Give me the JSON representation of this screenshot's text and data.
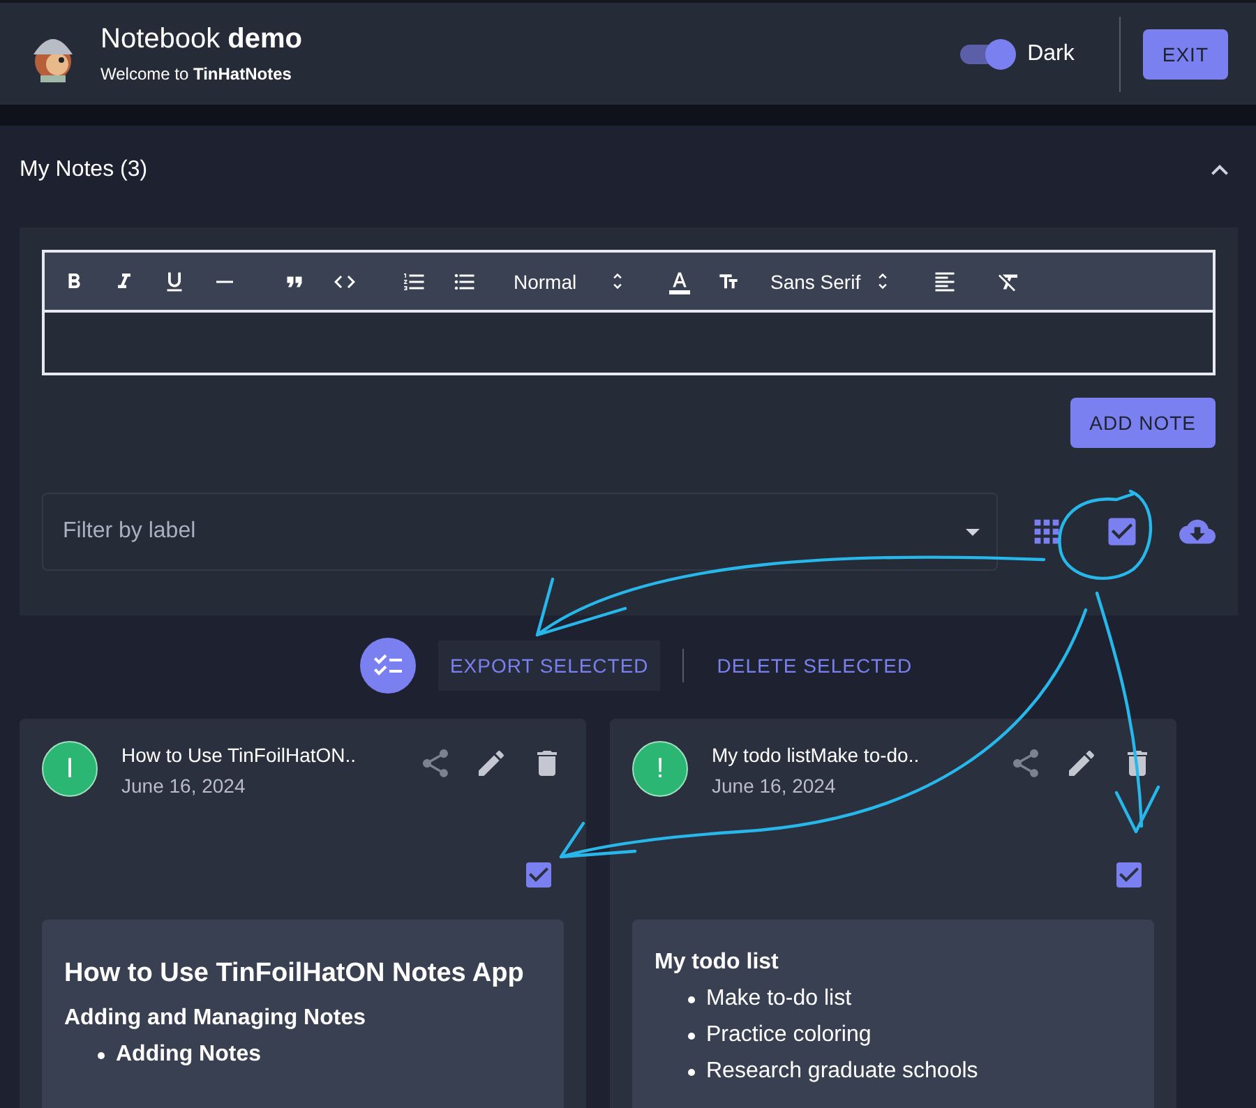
{
  "header": {
    "title": "Notebook **demo**",
    "subtitle": "Welcome to **TinHatNotes**",
    "theme_toggle": {
      "label": "Dark",
      "on": true
    },
    "exit_button": "EXIT"
  },
  "section": {
    "title": "My Notes (3)",
    "expanded": true
  },
  "editor": {
    "selects": [
      "Normal",
      "Sans Serif"
    ],
    "add_button": "ADD NOTE"
  },
  "filter": {
    "placeholder": "Filter by label"
  },
  "select_mode": {
    "on": true
  },
  "bulk_actions": {
    "export": "EXPORT SELECTED",
    "delete": "DELETE SELECTED"
  },
  "notes": [
    {
      "avatar": "I",
      "title": "How to Use TinFoilHatON..",
      "date": "June 16, 2024",
      "checked": true,
      "content": [
        {
          "kind": "h1",
          "text": "How to Use TinFoilHatON Notes App"
        },
        {
          "kind": "h2",
          "text": "Adding and Managing Notes"
        },
        {
          "kind": "bullet_bold",
          "text": "Adding Notes"
        }
      ]
    },
    {
      "avatar": "!",
      "title": "My todo listMake to-do..",
      "date": "June 16, 2024",
      "checked": true,
      "content": [
        {
          "kind": "h2",
          "text": "My todo list"
        },
        {
          "kind": "bullet",
          "text": "Make to-do list"
        },
        {
          "kind": "bullet",
          "text": "Practice coloring"
        },
        {
          "kind": "bullet",
          "text": "Research graduate schools"
        }
      ]
    }
  ]
}
